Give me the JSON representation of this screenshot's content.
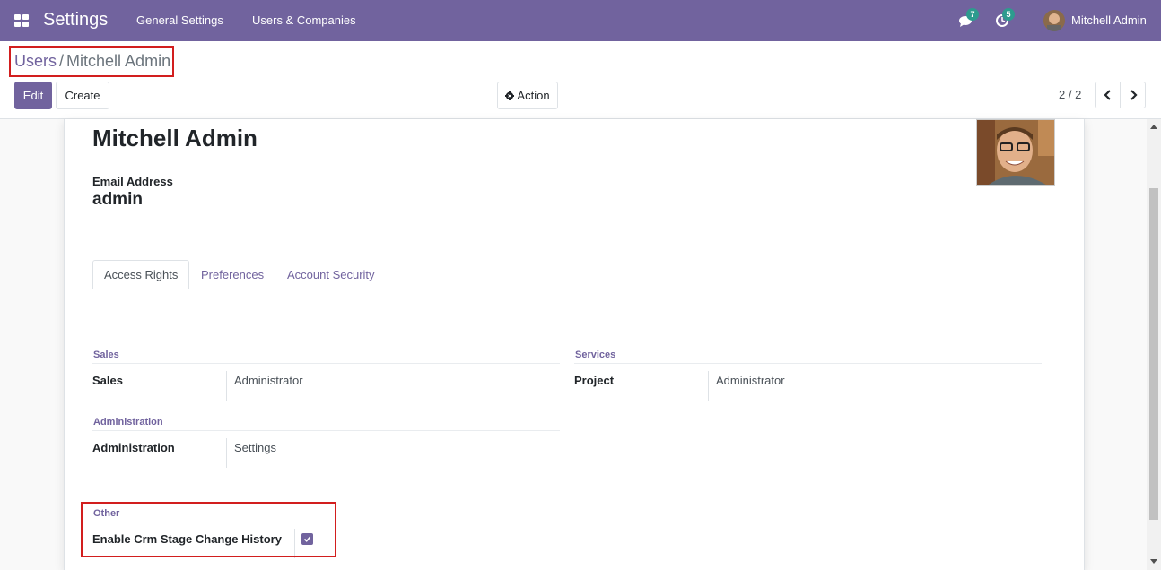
{
  "navbar": {
    "app_title": "Settings",
    "menu": [
      "General Settings",
      "Users & Companies"
    ],
    "messages_badge": "7",
    "activities_badge": "5",
    "user_name": "Mitchell Admin",
    "color": "#71639e"
  },
  "breadcrumb": {
    "parent": "Users",
    "separator": "/",
    "current": "Mitchell Admin"
  },
  "toolbar": {
    "edit_label": "Edit",
    "create_label": "Create",
    "action_label": "Action",
    "pager": "2 / 2"
  },
  "record": {
    "name": "Mitchell Admin",
    "email_label": "Email Address",
    "email_value": "admin"
  },
  "tabs": [
    {
      "label": "Access Rights",
      "active": true
    },
    {
      "label": "Preferences",
      "active": false
    },
    {
      "label": "Account Security",
      "active": false
    }
  ],
  "groups": {
    "sales": {
      "title": "Sales",
      "field_label": "Sales",
      "field_value": "Administrator"
    },
    "services": {
      "title": "Services",
      "field_label": "Project",
      "field_value": "Administrator"
    },
    "administration": {
      "title": "Administration",
      "field_label": "Administration",
      "field_value": "Settings"
    },
    "other": {
      "title": "Other",
      "field_label": "Enable Crm Stage Change History",
      "checked": true
    }
  },
  "icons": {
    "apps": "apps-grid-icon",
    "messages": "chat-bubbles-icon",
    "activities": "clock-icon",
    "action": "gear-icon",
    "prev": "chevron-left-icon",
    "next": "chevron-right-icon"
  }
}
